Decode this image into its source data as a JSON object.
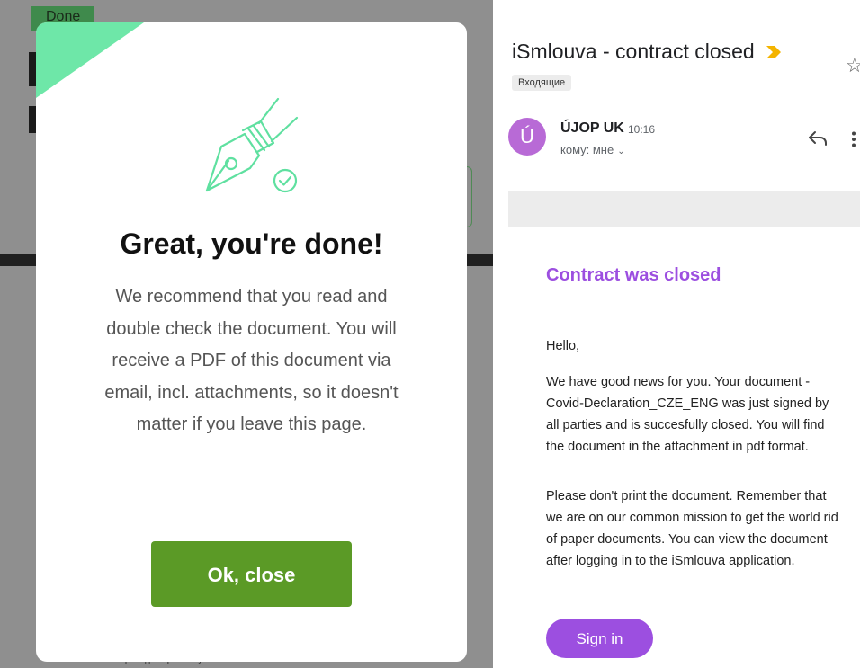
{
  "background": {
    "done_label": "Done",
    "footer_text": "как начало вечерния доклера по случаю"
  },
  "modal": {
    "icon": "fountain-pen-check-icon",
    "title": "Great, you're done!",
    "message": "We recommend that you read and double check the document. You will receive a PDF of this document via email, incl. attachments, so it doesn't matter if you leave this page.",
    "button_label": "Ok, close",
    "colors": {
      "corner": "#6ee7a8",
      "icon": "#5fe0a0",
      "button": "#5b9a26"
    }
  },
  "email": {
    "subject": "iSmlouva - contract closed",
    "important_icon": "importance-marker-icon",
    "label": "Входящие",
    "sender": {
      "avatar_letter": "Ú",
      "name": "ÚJOP UK",
      "time": "10:16",
      "to": "кому: мне",
      "avatar_color": "#b86ad6"
    },
    "actions": [
      "reply-icon",
      "more-vert-icon",
      "star-icon"
    ],
    "body": {
      "title": "Contract was closed",
      "greeting": "Hello,",
      "paragraph1": "We have good news for you. Your document  - Covid-Declaration_CZE_ENG was just signed by all parties and is succesfully closed. You will find the document in the attachment in pdf format.",
      "paragraph2": "Please don't print the document. Remember that we are on our common mission to get the world rid of paper documents. You can view the document after logging in to the iSmlouva application.",
      "button_label": "Sign in",
      "accent_color": "#9c4fe0"
    }
  }
}
